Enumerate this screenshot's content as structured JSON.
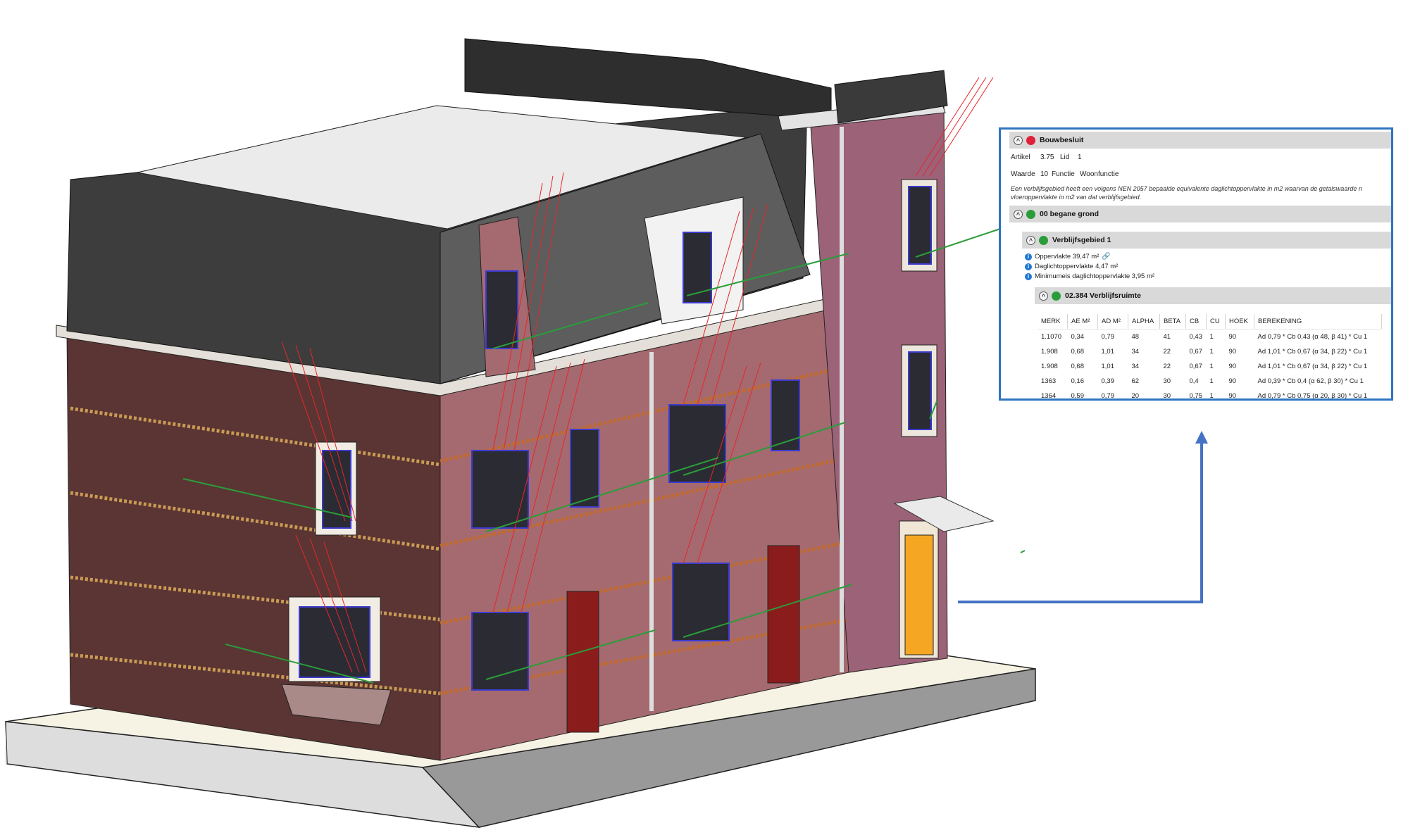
{
  "colors": {
    "accent_border": "#2f74c0",
    "arrow": "#4472c4",
    "status_fail": "#e0203a",
    "status_pass": "#2a9d3a",
    "info": "#1f78d1",
    "brick_dark": "#5a3533",
    "brick_light": "#a46a70",
    "roof": "#3d3d3d"
  },
  "scene": {
    "model_name": "building-3d-model"
  },
  "report": {
    "root": {
      "title": "Bouwbesluit",
      "status": "fail",
      "artikel_label": "Artikel",
      "artikel_value": "3.75",
      "lid_label": "Lid",
      "lid_value": "1",
      "waarde_label": "Waarde",
      "waarde_value": "10",
      "functie_label": "Functie",
      "functie_value": "Woonfunctie",
      "description_line1": "Een verblijfsgebied heeft een volgens NEN 2057 bepaalde equivalente daglichtoppervlakte in m2 waarvan de getalswaarde n",
      "description_line2": "vloeroppervlakte in m2 van dat verblijfsgebied."
    },
    "floor": {
      "title": "00 begane grond",
      "status": "pass"
    },
    "area": {
      "title": "Verblijfsgebied 1",
      "status": "pass",
      "info": [
        "Oppervlakte 39,47 m²",
        "Daglichtoppervlakte 4,47 m²",
        "Minimumeis daglichtoppervlakte 3,95 m²"
      ]
    },
    "room": {
      "title": "02.384 Verblijfsruimte",
      "status": "pass"
    },
    "table": {
      "headers": [
        "MERK",
        "AE M²",
        "AD M²",
        "ALPHA",
        "BETA",
        "CB",
        "CU",
        "HOEK",
        "BEREKENING"
      ],
      "rows": [
        [
          "1.1070",
          "0,34",
          "0,79",
          "48",
          "41",
          "0,43",
          "1",
          "90",
          "Ad 0,79 * Cb 0,43 (α 48, β 41) * Cu 1"
        ],
        [
          "1.908",
          "0,68",
          "1,01",
          "34",
          "22",
          "0,67",
          "1",
          "90",
          "Ad 1,01 * Cb 0,67 (α 34, β 22) * Cu 1"
        ],
        [
          "1.908",
          "0,68",
          "1,01",
          "34",
          "22",
          "0,67",
          "1",
          "90",
          "Ad 1,01 * Cb 0,67 (α 34, β 22) * Cu 1"
        ],
        [
          "1363",
          "0,16",
          "0,39",
          "62",
          "30",
          "0,4",
          "1",
          "90",
          "Ad 0,39 * Cb 0,4 (α 62, β 30) * Cu 1"
        ],
        [
          "1364",
          "0,59",
          "0,79",
          "20",
          "30",
          "0,75",
          "1",
          "90",
          "Ad 0,79 * Cb 0,75 (α 20, β 30) * Cu 1"
        ]
      ]
    }
  }
}
